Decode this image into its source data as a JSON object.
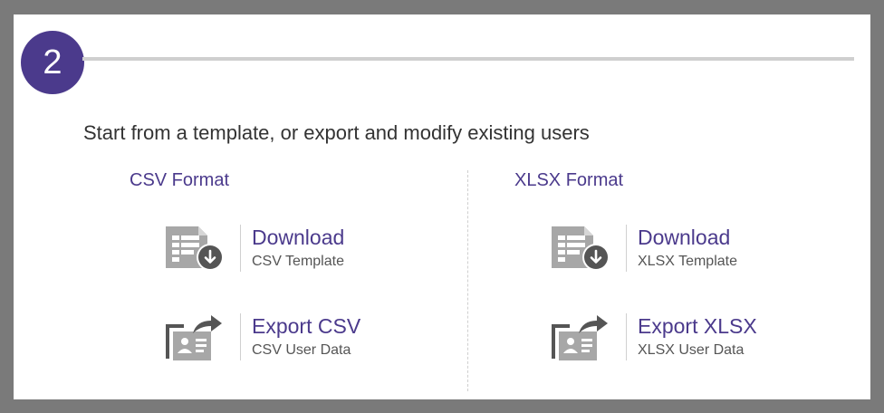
{
  "step": {
    "number": "2"
  },
  "heading": "Start from a template, or export and modify existing users",
  "columns": [
    {
      "title": "CSV Format",
      "download": {
        "label": "Download",
        "sub": "CSV Template"
      },
      "export": {
        "label": "Export CSV",
        "sub": "CSV User Data"
      }
    },
    {
      "title": "XLSX Format",
      "download": {
        "label": "Download",
        "sub": "XLSX Template"
      },
      "export": {
        "label": "Export XLSX",
        "sub": "XLSX User Data"
      }
    }
  ],
  "colors": {
    "accent": "#4b3a8c",
    "icon_gray": "#a7a7a7",
    "icon_dark": "#555555"
  },
  "icons": {
    "download": "spreadsheet-download-icon",
    "export": "user-card-export-icon"
  }
}
